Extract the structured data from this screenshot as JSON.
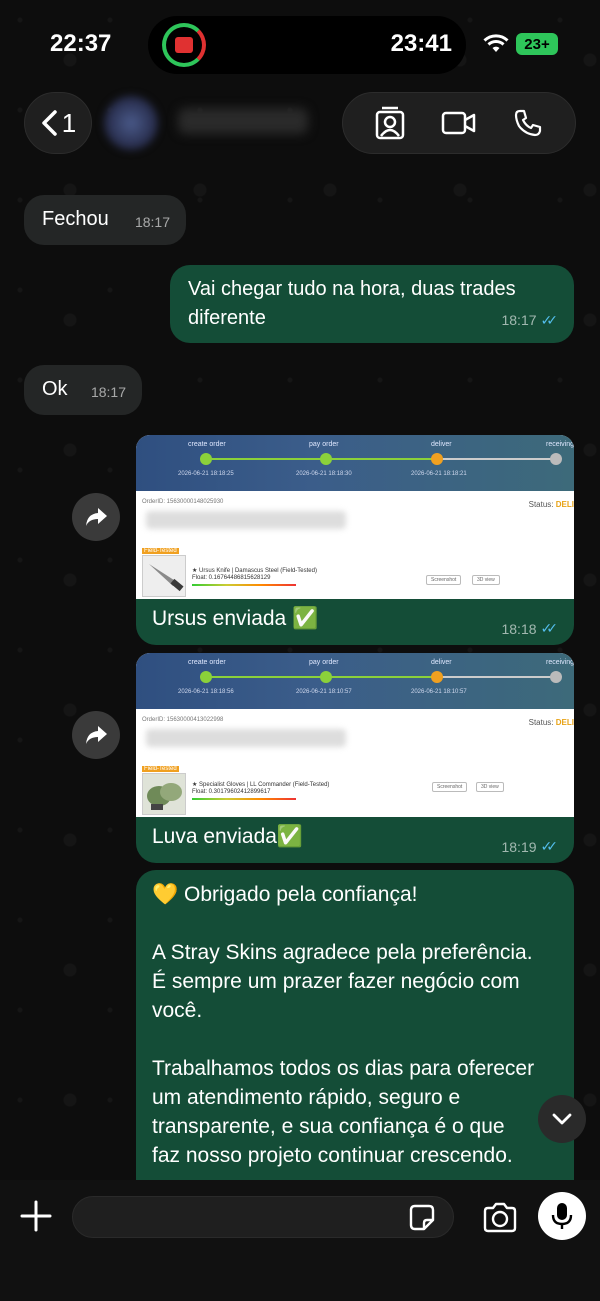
{
  "status_bar": {
    "time": "22:37",
    "island_time": "23:41",
    "battery": "23+"
  },
  "header": {
    "back_count": "1",
    "back_glyph": "<"
  },
  "messages": [
    {
      "id": "m1",
      "direction": "in",
      "text": "Fechou",
      "time": "18:17"
    },
    {
      "id": "m2",
      "direction": "out",
      "text_line1": "Vai chegar tudo na hora, duas trades",
      "text_line2": "diferente",
      "time": "18:17"
    },
    {
      "id": "m3",
      "direction": "in",
      "text": "Ok",
      "time": "18:17"
    }
  ],
  "image_messages": [
    {
      "steps": [
        "create order",
        "pay order",
        "deliver",
        "receiving"
      ],
      "dates": [
        "2026-06-21 18:18:25",
        "2026-06-21 18:18:30",
        "2026-06-21 18:18:21"
      ],
      "order_id": "OrderID: 15630000148025930",
      "status_label": "Status:",
      "status_value": "DELI",
      "tag": "Field-Tested",
      "item_name": "★ Ursus Knife | Damascus Steel (Field-Tested)",
      "float": "Float: 0.16764486815628129",
      "btn1": "Screenshot",
      "btn2": "3D view",
      "caption": "Ursus enviada ✅",
      "time": "18:18"
    },
    {
      "steps": [
        "create order",
        "pay order",
        "deliver",
        "receiving"
      ],
      "dates": [
        "2026-06-21 18:18:56",
        "2026-06-21 18:10:57",
        "2026-06-21 18:10:57"
      ],
      "order_id": "OrderID: 15630000413022998",
      "status_label": "Status:",
      "status_value": "DELI",
      "tag": "Field-Tested",
      "item_name": "★ Specialist Gloves | LL Commander (Field-Tested)",
      "float": "Float: 0.30179602412899617",
      "btn1": "Screenshot",
      "btn2": "3D view",
      "caption": "Luva enviada✅",
      "time": "18:19"
    }
  ],
  "long_message": {
    "line1": "💛 Obrigado pela confiança!",
    "line2": "A Stray Skins agradece pela preferência.",
    "line3": "É sempre um prazer fazer negócio com",
    "line4": "você.",
    "line5": "Trabalhamos todos os dias para oferecer",
    "line6": "um atendimento rápido, seguro e",
    "line7": "transparente, e sua confiança é o que",
    "line8": "faz nosso projeto continuar crescendo."
  },
  "composer": {
    "placeholder": "",
    "value": ""
  },
  "colors": {
    "incoming_bubble": "#242626",
    "outgoing_bubble": "#144d37",
    "read_ticks": "#53bdeb",
    "battery": "#2ec55a"
  },
  "icons": {
    "back": "chevron-left-icon",
    "contact_card": "contact-card-icon",
    "video": "video-camera-icon",
    "phone": "phone-icon",
    "forward": "forward-arrow-icon",
    "scroll": "chevron-down-icon",
    "plus": "plus-icon",
    "sticker": "sticker-icon",
    "camera": "camera-icon",
    "mic": "microphone-icon"
  }
}
